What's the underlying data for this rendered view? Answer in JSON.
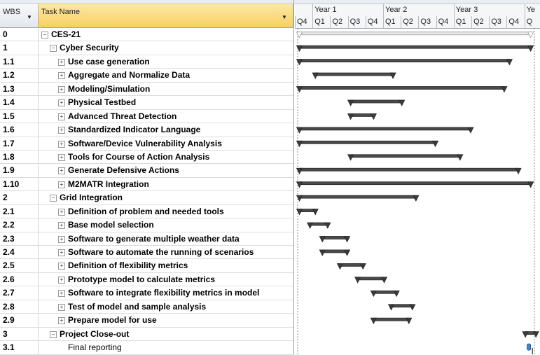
{
  "columns": {
    "wbs": "WBS",
    "task_name": "Task Name"
  },
  "timescale": {
    "years": [
      "Year 1",
      "Year 2",
      "Year 3",
      "Ye"
    ],
    "quarters": [
      "Q4",
      "Q1",
      "Q2",
      "Q3",
      "Q4",
      "Q1",
      "Q2",
      "Q3",
      "Q4",
      "Q1",
      "Q2",
      "Q3",
      "Q4",
      "Q"
    ]
  },
  "tasks": [
    {
      "wbs": "0",
      "name": "CES-21",
      "level": 0,
      "toggle": "−",
      "summary": true,
      "start": 0.1,
      "end": 13.2
    },
    {
      "wbs": "1",
      "name": "Cyber Security",
      "level": 1,
      "toggle": "−",
      "summary": true,
      "start": 0.1,
      "end": 13.2
    },
    {
      "wbs": "1.1",
      "name": "Use case generation",
      "level": 2,
      "toggle": "+",
      "summary": true,
      "start": 0.1,
      "end": 12.0
    },
    {
      "wbs": "1.2",
      "name": "Aggregate and Normalize Data",
      "level": 2,
      "toggle": "+",
      "summary": true,
      "start": 1.0,
      "end": 5.4
    },
    {
      "wbs": "1.3",
      "name": "Modeling/Simulation",
      "level": 2,
      "toggle": "+",
      "summary": true,
      "start": 0.1,
      "end": 11.7
    },
    {
      "wbs": "1.4",
      "name": "Physical Testbed",
      "level": 2,
      "toggle": "+",
      "summary": true,
      "start": 3.0,
      "end": 5.9
    },
    {
      "wbs": "1.5",
      "name": "Advanced Threat Detection",
      "level": 2,
      "toggle": "+",
      "summary": true,
      "start": 3.0,
      "end": 4.3
    },
    {
      "wbs": "1.6",
      "name": "Standardized Indicator Language",
      "level": 2,
      "toggle": "+",
      "summary": true,
      "start": 0.1,
      "end": 9.8
    },
    {
      "wbs": "1.7",
      "name": "Software/Device Vulnerability Analysis",
      "level": 2,
      "toggle": "+",
      "summary": true,
      "start": 0.1,
      "end": 7.8
    },
    {
      "wbs": "1.8",
      "name": "Tools for Course of Action Analysis",
      "level": 2,
      "toggle": "+",
      "summary": true,
      "start": 3.0,
      "end": 9.2
    },
    {
      "wbs": "1.9",
      "name": "Generate Defensive Actions",
      "level": 2,
      "toggle": "+",
      "summary": true,
      "start": 0.1,
      "end": 12.5
    },
    {
      "wbs": "1.10",
      "name": "M2MATR Integration",
      "level": 2,
      "toggle": "+",
      "summary": true,
      "start": 0.1,
      "end": 13.2
    },
    {
      "wbs": "2",
      "name": "Grid Integration",
      "level": 1,
      "toggle": "−",
      "summary": true,
      "start": 0.1,
      "end": 6.7
    },
    {
      "wbs": "2.1",
      "name": "Definition of problem and needed tools",
      "level": 2,
      "toggle": "+",
      "summary": true,
      "start": 0.1,
      "end": 1.0
    },
    {
      "wbs": "2.2",
      "name": "Base model selection",
      "level": 2,
      "toggle": "+",
      "summary": true,
      "start": 0.7,
      "end": 1.7
    },
    {
      "wbs": "2.3",
      "name": "Software to generate multiple weather data",
      "level": 2,
      "toggle": "+",
      "summary": true,
      "start": 1.4,
      "end": 2.8
    },
    {
      "wbs": "2.4",
      "name": "Software to automate the running of scenarios",
      "level": 2,
      "toggle": "+",
      "summary": true,
      "start": 1.4,
      "end": 2.8
    },
    {
      "wbs": "2.5",
      "name": "Definition of flexibility metrics",
      "level": 2,
      "toggle": "+",
      "summary": true,
      "start": 2.4,
      "end": 3.7
    },
    {
      "wbs": "2.6",
      "name": "Prototype model to calculate metrics",
      "level": 2,
      "toggle": "+",
      "summary": true,
      "start": 3.4,
      "end": 4.9
    },
    {
      "wbs": "2.7",
      "name": "Software to integrate flexibility metrics in model",
      "level": 2,
      "toggle": "+",
      "summary": true,
      "start": 4.3,
      "end": 5.6
    },
    {
      "wbs": "2.8",
      "name": "Test of model and sample analysis",
      "level": 2,
      "toggle": "+",
      "summary": true,
      "start": 5.3,
      "end": 6.5
    },
    {
      "wbs": "2.9",
      "name": "Prepare model for use",
      "level": 2,
      "toggle": "+",
      "summary": true,
      "start": 4.3,
      "end": 6.3
    },
    {
      "wbs": "3",
      "name": "Project Close-out",
      "level": 1,
      "toggle": "−",
      "summary": true,
      "start": 12.9,
      "end": 13.5
    },
    {
      "wbs": "3.1",
      "name": "Final reporting",
      "level": 2,
      "toggle": "",
      "summary": false,
      "start": 13.0,
      "end": 13.2
    }
  ]
}
